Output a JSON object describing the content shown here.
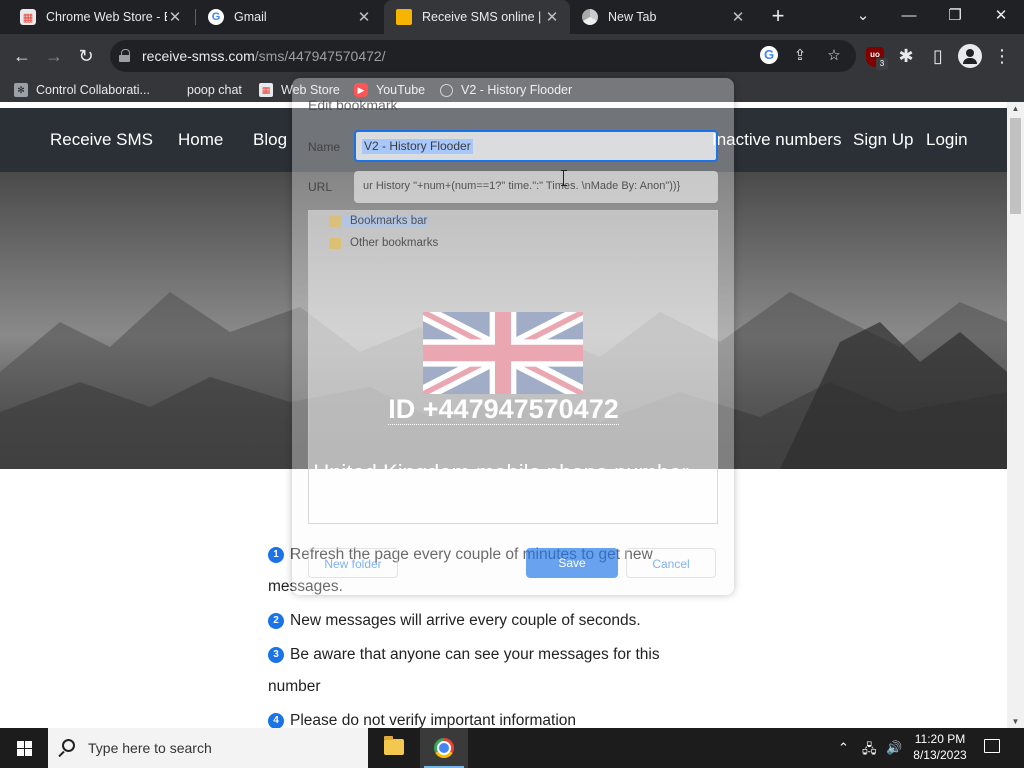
{
  "browser": {
    "tabs": [
      {
        "title": "Chrome Web Store - Ex",
        "icon": "chrome-web-store-icon",
        "active": false
      },
      {
        "title": "Gmail",
        "icon": "google-icon",
        "active": false
      },
      {
        "title": "Receive SMS online | Te",
        "icon": "receive-sms-icon",
        "active": true
      },
      {
        "title": "New Tab",
        "icon": "chrome-icon",
        "active": false
      }
    ],
    "close_glyph": "✕",
    "new_tab_glyph": "+",
    "url_host": "receive-smss.com",
    "url_path": "/sms/447947570472/",
    "bookmarks": [
      {
        "label": "Control Collaborati...",
        "icon": "bookmark-app-icon"
      },
      {
        "label": "poop chat",
        "icon": "bookmark-blank-icon"
      },
      {
        "label": "Web Store",
        "icon": "chrome-web-store-icon"
      },
      {
        "label": "YouTube",
        "icon": "youtube-icon"
      },
      {
        "label": "V2 - History Flooder",
        "icon": "globe-icon"
      }
    ],
    "extension_badge": "3"
  },
  "page": {
    "nav": {
      "brand": "Receive SMS",
      "links": [
        "Home",
        "Blog",
        "Inactive numbers",
        "Sign Up",
        "Login"
      ]
    },
    "hero": {
      "id_text": "ID +447947570472",
      "subtitle": "United Kingdom mobile phone number."
    },
    "steps": [
      {
        "num": "1",
        "text": "Refresh the page every couple of minutes to get new messages."
      },
      {
        "num": "2",
        "text": "New messages will arrive every couple of seconds."
      },
      {
        "num": "3",
        "text": "Be aware that anyone can see your messages for this number"
      },
      {
        "num": "4",
        "text": "Please do not verify important information"
      }
    ]
  },
  "dialog": {
    "title": "Edit bookmark",
    "name_label": "Name",
    "name_value": "V2 - History Flooder",
    "url_label": "URL",
    "url_value": "ur History \"+num+(num==1?\" time.\":\" Times. \\nMade By: Anon\"))}",
    "folders": [
      "Bookmarks bar",
      "Other bookmarks"
    ],
    "new_folder_label": "New folder",
    "save_label": "Save",
    "cancel_label": "Cancel"
  },
  "taskbar": {
    "search_placeholder": "Type here to search",
    "time": "11:20 PM",
    "date": "8/13/2023"
  },
  "colors": {
    "accent": "#1a73e8",
    "nav_bg": "#2b3036",
    "chrome_frame": "#202124",
    "chrome_toolbar": "#35363a"
  }
}
